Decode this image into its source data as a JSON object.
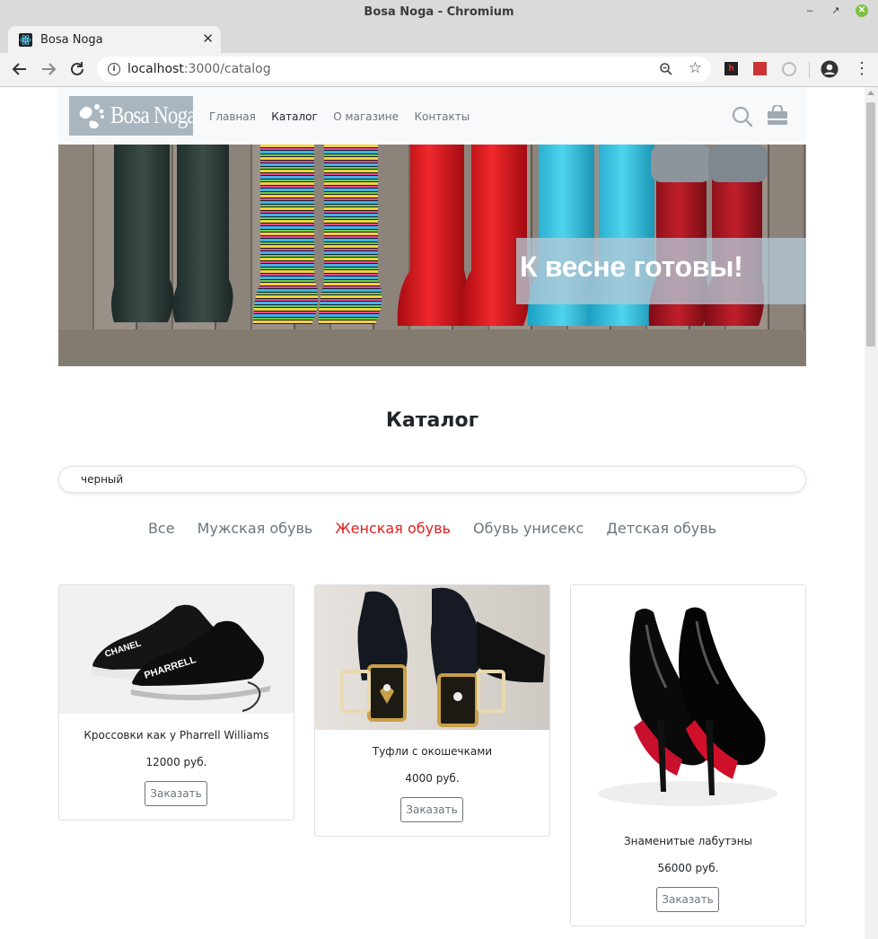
{
  "window": {
    "title": "Bosa Noga - Chromium"
  },
  "browser": {
    "tab_title": "Bosa Noga",
    "url_host": "localhost",
    "url_path": ":3000/catalog"
  },
  "header": {
    "logo_text": "Bosa Noga",
    "nav": [
      "Главная",
      "Каталог",
      "О магазине",
      "Контакты"
    ],
    "active_nav": "Каталог"
  },
  "banner": {
    "caption": "К весне готовы!"
  },
  "catalog": {
    "title": "Каталог",
    "search_value": "черный",
    "categories": [
      "Все",
      "Мужская обувь",
      "Женская обувь",
      "Обувь унисекс",
      "Детская обувь"
    ],
    "active_category": "Женская обувь",
    "products": [
      {
        "title": "Кроссовки как у Pharrell Williams",
        "price": "12000 руб.",
        "button": "Заказать",
        "image_icon": "sneakers-image"
      },
      {
        "title": "Туфли с окошечками",
        "price": "4000 руб.",
        "button": "Заказать",
        "image_icon": "jeweled-heels-image"
      },
      {
        "title": "Знаменитые лабутэны",
        "price": "56000 руб.",
        "button": "Заказать",
        "image_icon": "louboutin-heels-image"
      }
    ]
  },
  "colors": {
    "accent_red": "#e02020",
    "logo_bg": "#a9b5bf",
    "header_bg": "#f8f9fa"
  }
}
